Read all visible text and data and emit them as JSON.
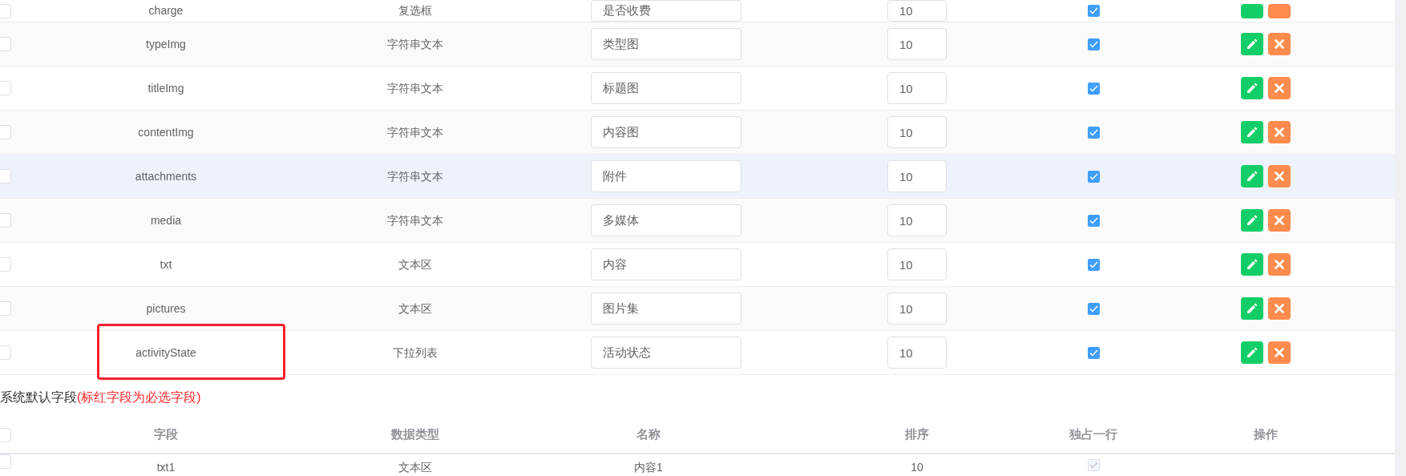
{
  "table": {
    "rows": [
      {
        "field": "charge",
        "data_type": "复选框",
        "name": "是否收费",
        "order": "10",
        "single_line": true,
        "hovered": false,
        "highlighted": false,
        "checked": false
      },
      {
        "field": "typeImg",
        "data_type": "字符串文本",
        "name": "类型图",
        "order": "10",
        "single_line": true,
        "hovered": false,
        "highlighted": false,
        "checked": false
      },
      {
        "field": "titleImg",
        "data_type": "字符串文本",
        "name": "标题图",
        "order": "10",
        "single_line": true,
        "hovered": false,
        "highlighted": false,
        "checked": false
      },
      {
        "field": "contentImg",
        "data_type": "字符串文本",
        "name": "内容图",
        "order": "10",
        "single_line": true,
        "hovered": false,
        "highlighted": false,
        "checked": false
      },
      {
        "field": "attachments",
        "data_type": "字符串文本",
        "name": "附件",
        "order": "10",
        "single_line": true,
        "hovered": true,
        "highlighted": false,
        "checked": false
      },
      {
        "field": "media",
        "data_type": "字符串文本",
        "name": "多媒体",
        "order": "10",
        "single_line": true,
        "hovered": false,
        "highlighted": false,
        "checked": false
      },
      {
        "field": "txt",
        "data_type": "文本区",
        "name": "内容",
        "order": "10",
        "single_line": true,
        "hovered": false,
        "highlighted": false,
        "checked": false
      },
      {
        "field": "pictures",
        "data_type": "文本区",
        "name": "图片集",
        "order": "10",
        "single_line": true,
        "hovered": false,
        "highlighted": false,
        "checked": false
      },
      {
        "field": "activityState",
        "data_type": "下拉列表",
        "name": "活动状态",
        "order": "10",
        "single_line": true,
        "hovered": false,
        "highlighted": true,
        "checked": false
      }
    ]
  },
  "default_section": {
    "title": "系统默认字段",
    "note": "(标红字段为必选字段)",
    "select_all_checked": false,
    "columns": [
      "字段",
      "数据类型",
      "名称",
      "排序",
      "独占一行",
      "操作"
    ],
    "rows": [
      {
        "field": "txt1",
        "data_type": "文本区",
        "name": "内容1",
        "order": "10",
        "single_line": true,
        "disabled": true,
        "checked": false
      }
    ]
  }
}
